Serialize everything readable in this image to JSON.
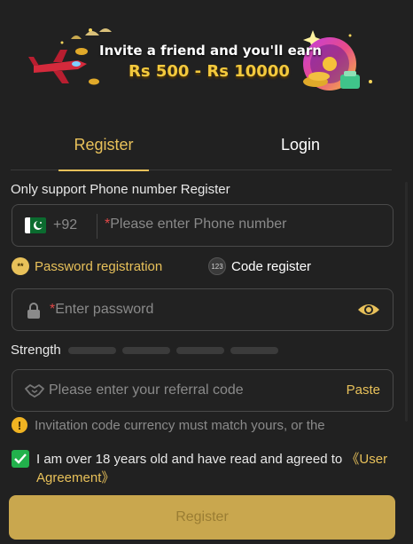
{
  "banner": {
    "line1": "Invite a friend and you'll earn",
    "line2": "Rs 500 - Rs 10000"
  },
  "tabs": [
    {
      "label": "Register",
      "active": true
    },
    {
      "label": "Login",
      "active": false
    }
  ],
  "support_text": "Only support Phone number Register",
  "phone": {
    "country_code": "+92",
    "flag": "pakistan-flag",
    "required_mark": "*",
    "placeholder": "Please enter Phone number"
  },
  "registration_options": {
    "password": "Password registration",
    "code": "Code register",
    "code_icon_text": "123"
  },
  "password": {
    "required_mark": "*",
    "placeholder": "Enter password"
  },
  "strength": {
    "label": "Strength",
    "level": 0
  },
  "referral": {
    "placeholder": "Please enter your referral code",
    "paste_label": "Paste"
  },
  "notice": {
    "text": "Invitation code currency must match yours, or the"
  },
  "agreement": {
    "checked": true,
    "text": "I am over 18 years old and have read and agreed to ",
    "link": "《User Agreement》"
  },
  "submit_label": "Register",
  "colors": {
    "accent": "#e8c15a",
    "background": "#212121",
    "check": "#22b14c",
    "warning": "#f0b322",
    "required": "#e04848"
  }
}
